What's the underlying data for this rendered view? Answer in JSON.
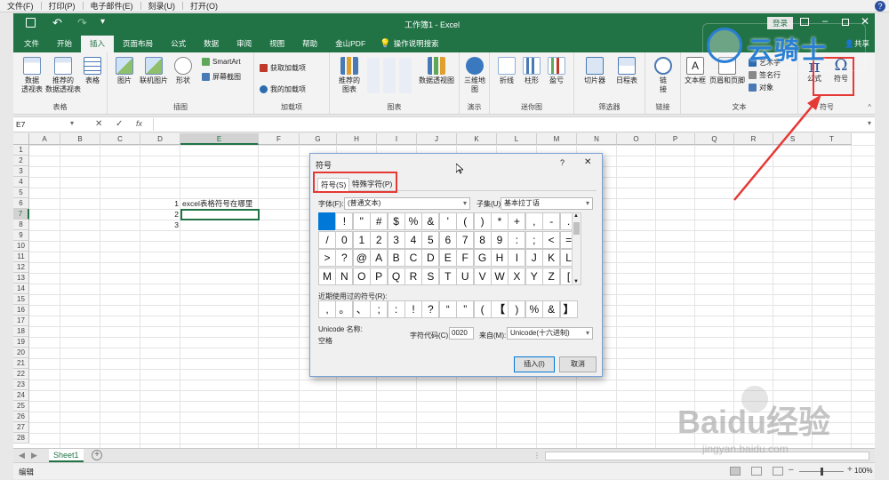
{
  "top_menu": [
    "文件(F)",
    "打印(P)",
    "电子邮件(E)",
    "刻录(U)",
    "打开(O)"
  ],
  "help_glyph": "?",
  "title": "工作簿1 - Excel",
  "login_label": "登录",
  "share_label": "共享",
  "tabs": [
    "文件",
    "开始",
    "插入",
    "页面布局",
    "公式",
    "数据",
    "审阅",
    "视图",
    "帮助",
    "金山PDF"
  ],
  "tell_me": "操作说明搜索",
  "ribbon": {
    "groups": {
      "tables": "表格",
      "illustrations": "插图",
      "addins": "加载项",
      "charts": "图表",
      "tours": "演示",
      "sparklines": "迷你图",
      "filters": "筛选器",
      "links": "链接",
      "text": "文本",
      "symbols": "符号"
    },
    "buttons": {
      "pivot": "数据\n透视表",
      "recommended_pivot": "推荐的\n数据透视表",
      "table": "表格",
      "picture": "图片",
      "online_picture": "联机图片",
      "shapes": "形状",
      "smartart": "SmartArt",
      "screenshot": "屏幕截图",
      "get_addins": "获取加载项",
      "my_addins": "我的加载项",
      "recommended_charts": "推荐的\n图表",
      "pivot_chart": "数据透视图",
      "map3d": "三维地\n图",
      "line": "折线",
      "column": "柱形",
      "winloss": "盈亏",
      "slicer": "切片器",
      "timeline": "日程表",
      "link": "链\n接",
      "textbox": "文本框",
      "header_footer": "页眉和页脚",
      "wordart": "艺术字",
      "signature": "签名行",
      "object": "对象",
      "equation": "公式",
      "symbol": "符号"
    }
  },
  "name_box": "E7",
  "formula_icons": [
    "✕",
    "✓",
    "fx"
  ],
  "columns": [
    "A",
    "B",
    "C",
    "D",
    "E",
    "F",
    "G",
    "H",
    "I",
    "J",
    "K",
    "L",
    "M",
    "N",
    "O",
    "P",
    "Q",
    "R",
    "S",
    "T"
  ],
  "rows": [
    "1",
    "2",
    "3",
    "4",
    "5",
    "6",
    "7",
    "8",
    "9",
    "10",
    "11",
    "12",
    "13",
    "14",
    "15",
    "16",
    "17",
    "18",
    "19",
    "20",
    "21",
    "22",
    "23",
    "24",
    "25",
    "26",
    "27",
    "28"
  ],
  "cells": {
    "d6": "1",
    "e6": "excel表格符号在哪里",
    "d7": "2",
    "d8": "3"
  },
  "sheet_tab": "Sheet1",
  "status": {
    "mode": "编辑",
    "zoom": "100%"
  },
  "watermark": {
    "yunqishi": "云骑士",
    "baidu": "Baidu经验",
    "url": "jingyan.baidu.com"
  },
  "dialog": {
    "title": "符号",
    "help": "?",
    "close": "✕",
    "tab_symbols": "符号(S)",
    "tab_special": "特殊字符(P)",
    "font_label": "字体(F):",
    "font_value": "(普通文本)",
    "subset_label": "子集(U):",
    "subset_value": "基本拉丁语",
    "symbols": [
      " ",
      "!",
      "\"",
      "#",
      "$",
      "%",
      "&",
      "'",
      "(",
      ")",
      "*",
      "+",
      ",",
      "-",
      ".",
      "/",
      "0",
      "1",
      "2",
      "3",
      "4",
      "5",
      "6",
      "7",
      "8",
      "9",
      ":",
      ";",
      "<",
      "=",
      ">",
      "?",
      "@",
      "A",
      "B",
      "C",
      "D",
      "E",
      "F",
      "G",
      "H",
      "I",
      "J",
      "K",
      "L",
      "M",
      "N",
      "O",
      "P",
      "Q",
      "R",
      "S",
      "T",
      "U",
      "V",
      "W",
      "X",
      "Y",
      "Z",
      "["
    ],
    "recent_label": "近期使用过的符号(R):",
    "recent": [
      ",",
      "。",
      "、",
      ";",
      ":",
      "!",
      "?",
      "“",
      "”",
      "(",
      "【",
      ")",
      "%",
      "&",
      "】"
    ],
    "unicode_name_label": "Unicode 名称:",
    "unicode_name_value": "空格",
    "char_code_label": "字符代码(C):",
    "char_code_value": "0020",
    "from_label": "来自(M):",
    "from_value": "Unicode(十六进制)",
    "insert": "插入(I)",
    "cancel": "取消"
  },
  "colors": {
    "excel_green": "#217346",
    "selection": "#0078d7",
    "highlight_red": "#e53935"
  }
}
